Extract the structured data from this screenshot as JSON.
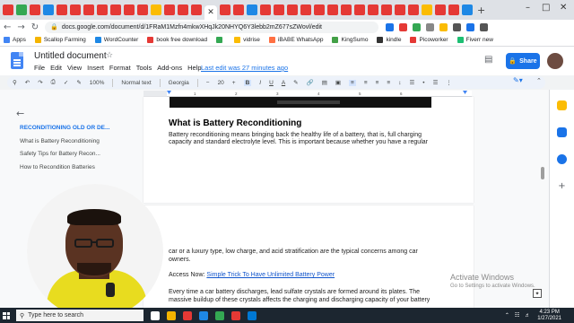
{
  "browser": {
    "tab_count_colors": [
      "#e53935",
      "#34a853",
      "#e53935",
      "#1e88e5",
      "#e53935",
      "#e53935",
      "#e53935",
      "#e53935",
      "#e53935",
      "#e53935",
      "#e53935",
      "#fbbc04",
      "#e53935",
      "#e53935",
      "#e53935",
      "#e53935",
      "#e53935",
      "#1e88e5",
      "#e53935",
      "#e53935",
      "#e53935",
      "#e53935",
      "#e53935",
      "#e53935",
      "#e53935",
      "#e53935",
      "#e53935",
      "#e53935",
      "#e53935",
      "#e53935",
      "#fbbc04",
      "#e53935",
      "#e53935",
      "#1e88e5"
    ],
    "active_tab_glyph": "✕",
    "new_tab": "+",
    "window_minimize": "–",
    "window_maximize": "□",
    "window_close": "✕",
    "url": "docs.google.com/document/d/1FRaM1Mzfn4mkwXHqJk20NHYQ6Y3lebb2mZ677sZWovl/edit",
    "extension_colors": [
      "#1a73e8",
      "#e53935",
      "#34a853",
      "#888888",
      "#fbbc04",
      "#555555",
      "#1a73e8",
      "#555555"
    ],
    "bookmarks": [
      {
        "label": "Apps",
        "color": "#4285f4"
      },
      {
        "label": "Scallop Farming",
        "color": "#f4b400"
      },
      {
        "label": "WordCounter",
        "color": "#1e88e5"
      },
      {
        "label": "book free download",
        "color": "#e53935"
      },
      {
        "label": "",
        "color": "#34a853"
      },
      {
        "label": "vidrise",
        "color": "#fbbc04"
      },
      {
        "label": "iBABE WhatsApp",
        "color": "#ff7043"
      },
      {
        "label": "KingSumo",
        "color": "#43a047"
      },
      {
        "label": "kindle",
        "color": "#333333"
      },
      {
        "label": "Picoworker",
        "color": "#e53935"
      },
      {
        "label": "Fiverr new",
        "color": "#1dbf73"
      }
    ]
  },
  "docs": {
    "title": "Untitled document",
    "menu": [
      "File",
      "Edit",
      "View",
      "Insert",
      "Format",
      "Tools",
      "Add-ons",
      "Help"
    ],
    "last_edit": "Last edit was 27 minutes ago",
    "share_label": "Share",
    "toolbar": {
      "zoom": "100%",
      "style": "Normal text",
      "font": "Georgia",
      "font_size": "20",
      "bold": "B",
      "italic": "I",
      "underline": "U",
      "text_color": "A"
    }
  },
  "outline": {
    "items": [
      {
        "label": "RECONDITIONING OLD OR DE...",
        "active": true
      },
      {
        "label": "What is Battery Reconditioning",
        "active": false
      },
      {
        "label": "Safety Tips for Battery Recon...",
        "active": false
      },
      {
        "label": "How to Recondition Batteries",
        "active": false
      }
    ]
  },
  "document": {
    "heading": "What is Battery Reconditioning",
    "para1_line1": "Battery reconditioning means bringing back the healthy life of a battery, that is, full charging",
    "para1_line2": "capacity and standard electrolyte level. This is important because whether you have a regular",
    "para2_line1": "car or a luxury type, low charge, and acid stratification are the typical concerns among car",
    "para2_line2": "owners.",
    "access_label": "Access Now: ",
    "access_link": "Simple Trick To Have Unlimited Battery Power",
    "para3_line1": "Every time a car battery discharges, lead sulfate crystals are formed around its plates. The",
    "para3_line2": "massive buildup of these crystals affects the charging and discharging capacity of your battery"
  },
  "watermark": {
    "title": "Activate Windows",
    "subtitle": "Go to Settings to activate Windows."
  },
  "taskbar": {
    "search_placeholder": "Type here to search",
    "app_colors": [
      "#ffffff",
      "#f4b400",
      "#e53935",
      "#1e88e5",
      "#34a853",
      "#e53935",
      "#0078d4"
    ],
    "time": "4:23 PM",
    "date": "1/27/2021"
  }
}
